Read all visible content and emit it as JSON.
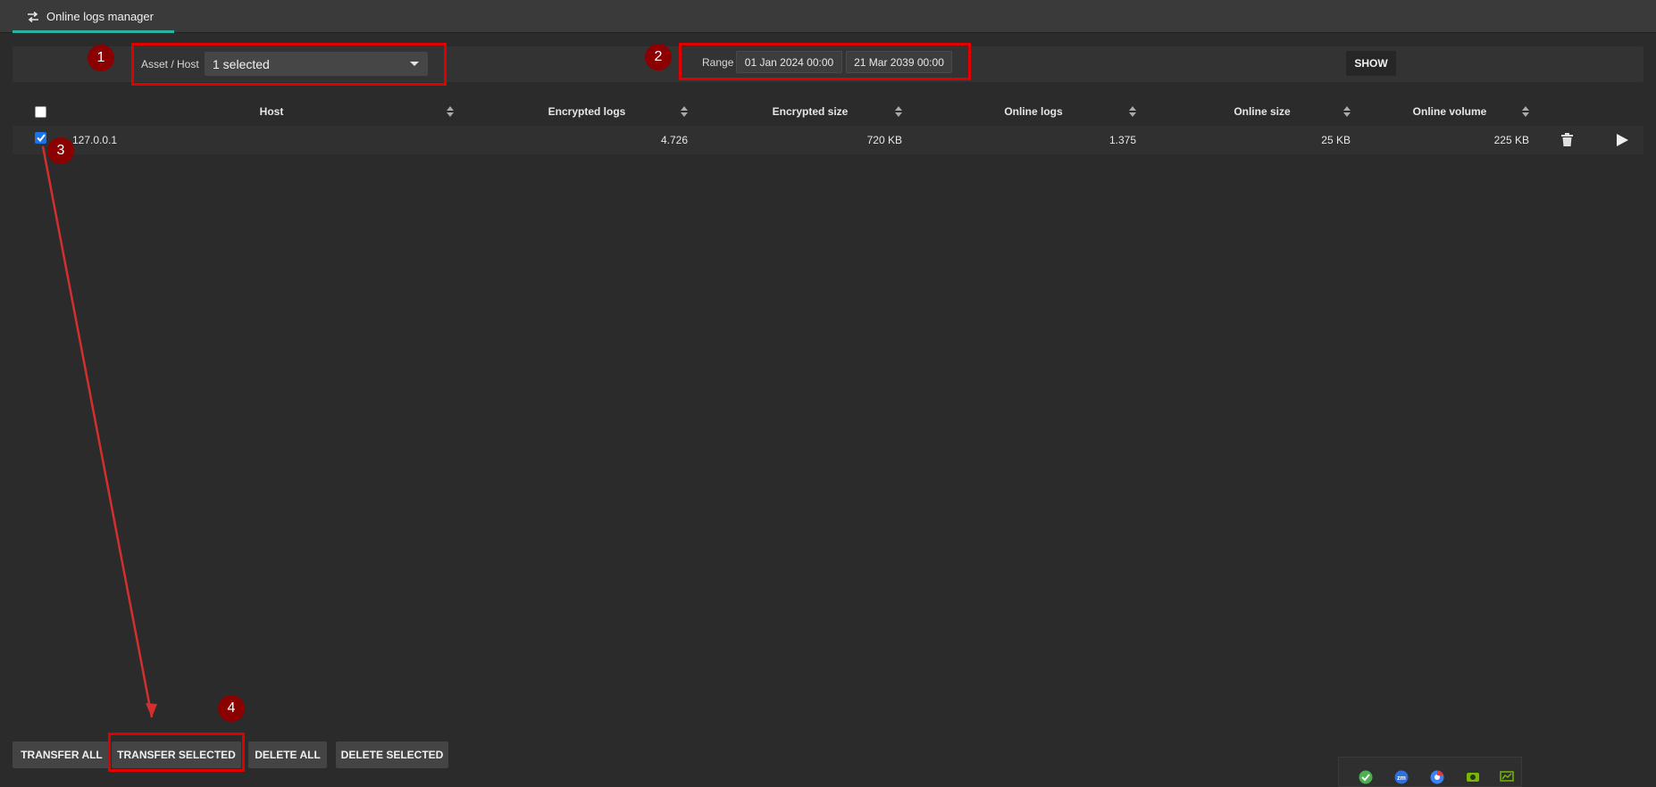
{
  "tab": {
    "icon": "swap-arrows-icon",
    "label": "Online logs manager"
  },
  "filters": {
    "host_label": "Asset / Host",
    "host_value": "1 selected",
    "range_label": "Range",
    "range_from": "01 Jan 2024 00:00",
    "range_to": "21 Mar 2039 00:00",
    "show_label": "SHOW"
  },
  "table": {
    "columns": [
      "Host",
      "Encrypted logs",
      "Encrypted size",
      "Online logs",
      "Online size",
      "Online volume"
    ],
    "rows": [
      {
        "checked": true,
        "host": "127.0.0.1",
        "encrypted_logs": "4.726",
        "encrypted_size": "720 KB",
        "online_logs": "1.375",
        "online_size": "25 KB",
        "online_volume": "225 KB"
      }
    ]
  },
  "actions": {
    "transfer_all": "TRANSFER ALL",
    "transfer_selected": "TRANSFER SELECTED",
    "delete_all": "DELETE ALL",
    "delete_selected": "DELETE SELECTED"
  },
  "annotations": {
    "marker_1": "1",
    "marker_2": "2",
    "marker_3": "3",
    "marker_4": "4",
    "color": "#e00000"
  },
  "tray_icons": [
    "green-check-icon",
    "zm-badge-icon",
    "chrome-like-icon",
    "nvidia-like-icon",
    "network-monitor-icon"
  ]
}
